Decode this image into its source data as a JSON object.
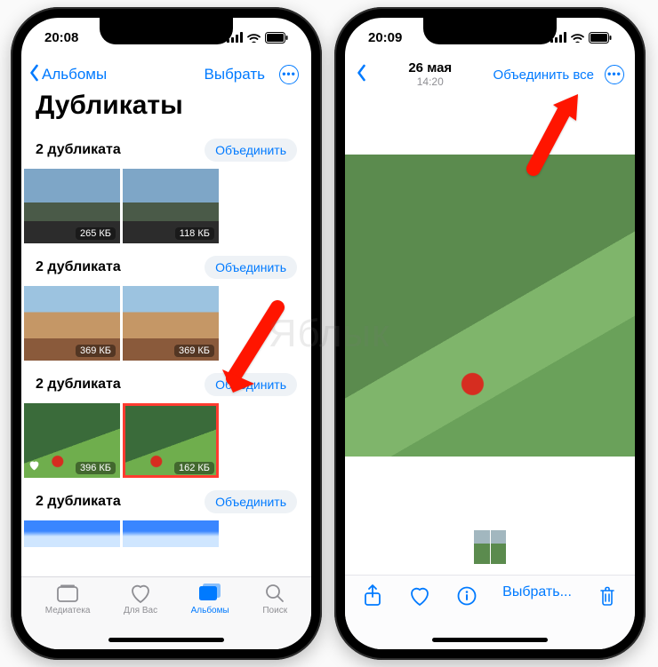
{
  "watermark": "Яблык",
  "left": {
    "status_time": "20:08",
    "back_label": "Альбомы",
    "select_label": "Выбрать",
    "title": "Дубликаты",
    "groups": [
      {
        "count_label": "2 дубликата",
        "merge_label": "Объединить",
        "items": [
          {
            "size": "265 КБ"
          },
          {
            "size": "118 КБ"
          }
        ],
        "scene": "car"
      },
      {
        "count_label": "2 дубликата",
        "merge_label": "Объединить",
        "items": [
          {
            "size": "369 КБ"
          },
          {
            "size": "369 КБ"
          }
        ],
        "scene": "town"
      },
      {
        "count_label": "2 дубликата",
        "merge_label": "Объединить",
        "items": [
          {
            "size": "396 КБ",
            "fav": true
          },
          {
            "size": "162 КБ",
            "selected": true
          }
        ],
        "scene": "mtn"
      },
      {
        "count_label": "2 дубликата",
        "merge_label": "Объединить",
        "items": [
          {
            "size": ""
          },
          {
            "size": ""
          }
        ],
        "scene": "sky"
      }
    ],
    "tabs": {
      "library": "Медиатека",
      "foryou": "Для Вас",
      "albums": "Альбомы",
      "search": "Поиск"
    }
  },
  "right": {
    "status_time": "20:09",
    "date": "26 мая",
    "time": "14:20",
    "merge_all_label": "Объединить все",
    "select_label": "Выбрать..."
  }
}
